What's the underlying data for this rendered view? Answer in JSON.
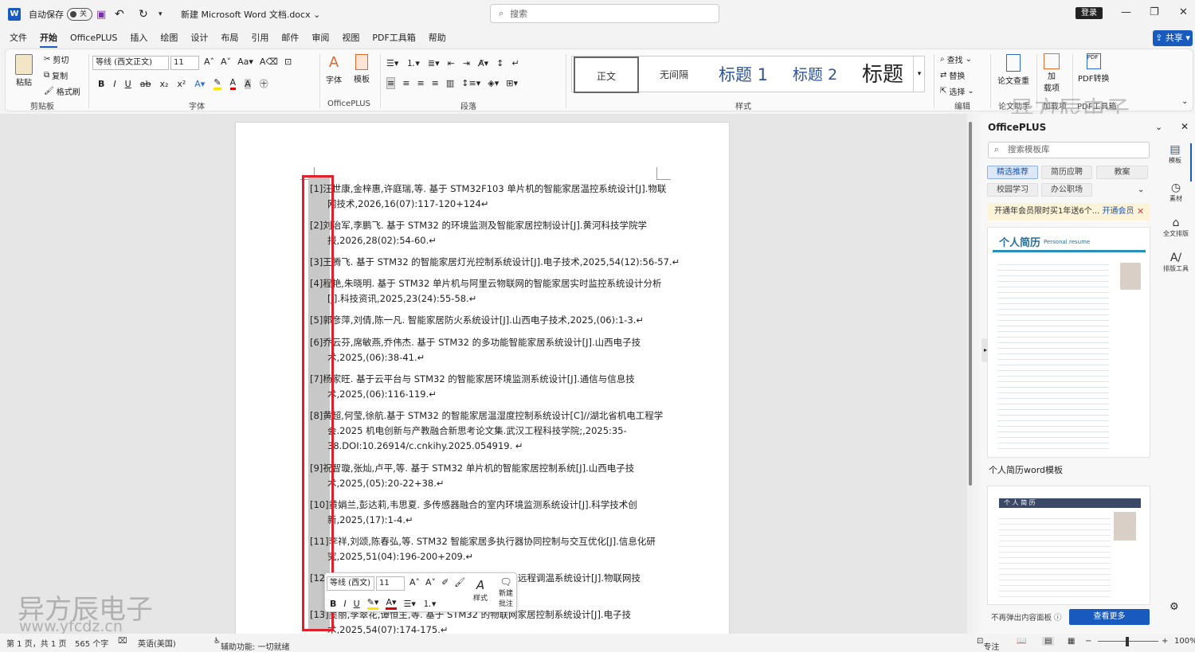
{
  "titlebar": {
    "autosave": "自动保存",
    "toggle": "关",
    "doc_title": "新建 Microsoft Word 文档.docx",
    "search_placeholder": "搜索",
    "login": "登录"
  },
  "tabs": [
    "文件",
    "开始",
    "OfficePLUS",
    "插入",
    "绘图",
    "设计",
    "布局",
    "引用",
    "邮件",
    "审阅",
    "视图",
    "PDF工具箱",
    "帮助"
  ],
  "active_tab": "开始",
  "share": "共享",
  "ribbon": {
    "clipboard": {
      "paste": "粘贴",
      "cut": "剪切",
      "copy": "复制",
      "format_painter": "格式刷",
      "label": "剪贴板"
    },
    "font": {
      "font_name": "等线 (西文正文)",
      "font_size": "11",
      "label": "字体"
    },
    "officeplus": {
      "font_btn": "字体",
      "template_btn": "模板",
      "label": "OfficePLUS"
    },
    "paragraph": {
      "label": "段落"
    },
    "styles": {
      "items": [
        "正文",
        "无间隔",
        "标题 1",
        "标题 2",
        "标题"
      ],
      "label": "样式"
    },
    "editing": {
      "find": "查找",
      "replace": "替换",
      "select": "选择",
      "label": "编辑"
    },
    "paper": {
      "check": "论文查重",
      "label": "论文助手"
    },
    "addins": {
      "btn1": "加",
      "btn2": "载项",
      "label": "加载项"
    },
    "pdf": {
      "convert": "PDF转换",
      "label": "PDF工具箱"
    }
  },
  "references": [
    {
      "l1": "[1]汪世康,金梓惠,许庭瑞,等. 基于 STM32F103 单片机的智能家居温控系统设计[J].物联",
      "l2": "网技术,2026,16(07):117-120+124↵"
    },
    {
      "l1": "[2]刘治军,李鹏飞. 基于 STM32 的环境监测及智能家居控制设计[J].黄河科技学院学",
      "l2": "报,2026,28(02):54-60.↵"
    },
    {
      "l1": "[3]王腾飞. 基于 STM32 的智能家居灯光控制系统设计[J].电子技术,2025,54(12):56-57.↵",
      "l2": ""
    },
    {
      "l1": "[4]程艳,朱晓明. 基于 STM32 单片机与阿里云物联网的智能家居实时监控系统设计分析",
      "l2": "[J].科技资讯,2025,23(24):55-58.↵"
    },
    {
      "l1": "[5]郭彦萍,刘倩,陈一凡. 智能家居防火系统设计[J].山西电子技术,2025,(06):1-3.↵",
      "l2": ""
    },
    {
      "l1": "[6]乔云芬,席敏燕,乔伟杰. 基于 STM32 的多功能智能家居系统设计[J].山西电子技",
      "l2": "术,2025,(06):38-41.↵"
    },
    {
      "l1": "[7]杨家旺. 基于云平台与 STM32 的智能家居环境监测系统设计[J].通信与信息技",
      "l2": "术,2025,(06):116-119.↵"
    },
    {
      "l1": "[8]黄超,何莹,徐航.基于 STM32 的智能家居温湿度控制系统设计[C]//湖北省机电工程学",
      "l2": "会.2025 机电创新与产教融合新思考论文集.武汉工程科技学院;,2025:35-",
      "l3": "38.DOI:10.26914/c.cnkihy.2025.054919. ↵"
    },
    {
      "l1": "[9]祝智璇,张灿,卢平,等. 基于 STM32 单片机的智能家居控制系统[J].山西电子技",
      "l2": "术,2025,(05):20-22+38.↵"
    },
    {
      "l1": "[10]黄娟兰,彭达莉,韦思夏. 多传感器融合的室内环境监测系统设计[J].科学技术创",
      "l2": "新,2025,(17):1-4.↵"
    },
    {
      "l1": "[11]李祥,刘颂,陈春弘,等. STM32 智能家居多执行器协同控制与交互优化[J].信息化研",
      "l2": "究,2025,51(04):196-200+209.↵"
    },
    {
      "l1": "[12",
      "l2": ""
    },
    {
      "l1": "[13]吴丽,李翠花,谭恒主,等. 基于 STM32 的物联网家居控制系统设计[J].电子技",
      "l2": "术,2025,54(07):174-175.↵"
    }
  ],
  "ref12_tail": "远程调温系统设计[J].物联网技",
  "mini_toolbar": {
    "font": "等线 (西文)",
    "size": "11",
    "style": "样式",
    "new_comment_1": "新建",
    "new_comment_2": "批注"
  },
  "panel": {
    "title": "OfficePLUS",
    "search_placeholder": "搜索模板库",
    "chips": [
      "精选推荐",
      "简历应聘",
      "教案",
      "校园学习",
      "办公职场"
    ],
    "promo": "开通年会员限时买1年送6个...",
    "promo_link": "开通会员",
    "card1_title": "个人简历",
    "card1_sub": "Personal resume",
    "card1_caption": "个人简历word模板",
    "card2_title": "个 人 简 历",
    "no_popup": "不再弹出内容面板",
    "see_more": "查看更多"
  },
  "rail": [
    "模板",
    "素材",
    "全文排版",
    "排版工具"
  ],
  "status": {
    "page": "第 1 页，共 1 页",
    "words": "565 个字",
    "lang": "英语(美国)",
    "accessibility": "辅助功能: 一切就绪",
    "focus": "专注",
    "zoom": "100%"
  },
  "watermark": {
    "cn": "异方辰电子",
    "url": "www.yfcdz.cn"
  }
}
